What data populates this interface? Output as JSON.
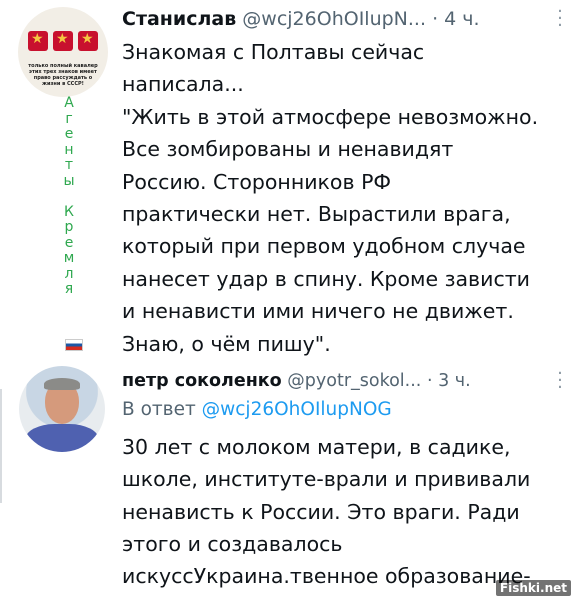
{
  "tweets": [
    {
      "name": "Станислав",
      "handle": "@wcj26OhOIlupN...",
      "time": "4 ч.",
      "text": "Знакомая с Полтавы сейчас\nнаписала...\n\"Жить в этой атмосфере невозможно.\nВсе зомбированы и ненавидят\nРоссию. Сторонников РФ\nпрактически нет. Вырастили врага,\nкоторый при первом удобном случае\nнанесет удар в спину. Кроме зависти\nи ненависти ими ничего не движет.\nЗнаю, о чём пишу\".",
      "avatar_caption": "только полный кавалер этих трех знаков имеет право рассуждать о жизни в СССР!",
      "vertical_tag": [
        "А",
        "г",
        "е",
        "н",
        "т",
        "ы",
        "",
        "К",
        "р",
        "е",
        "м",
        "л",
        "я"
      ]
    },
    {
      "name": "петр соколенко",
      "handle": "@pyotr_sokol...",
      "time": "3 ч.",
      "reply_prefix": "В ответ",
      "reply_handle": "@wcj26OhOIlupNOG",
      "text": "30 лет с молоком матери, в садике,\nшколе, институте-врали и прививали\nненависть к России. Это враги. Ради\nэтого и создавалось\nискуссУкраина.твенное образование-"
    }
  ],
  "separator_dot": "·",
  "more_icon": "more-vertical-icon",
  "watermark": "Fishki.net",
  "colors": {
    "text": "#0f1419",
    "muted": "#536471",
    "link": "#1d9bf0",
    "vertical_tag": "#2fa84f"
  }
}
